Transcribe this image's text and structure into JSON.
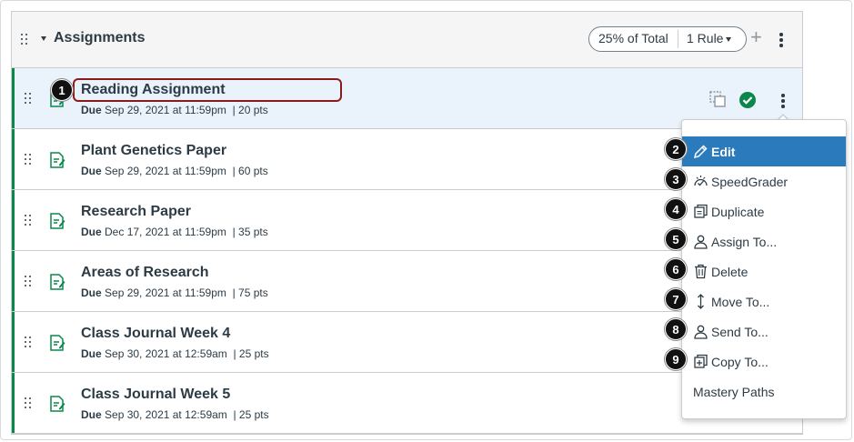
{
  "group": {
    "title": "Assignments",
    "weight_label": "25% of Total",
    "rule_label": "1 Rule"
  },
  "assignments": [
    {
      "title": "Reading Assignment",
      "due_label": "Due",
      "due": "Sep 29, 2021 at 11:59pm",
      "points": "| 20 pts"
    },
    {
      "title": "Plant Genetics Paper",
      "due_label": "Due",
      "due": "Sep 29, 2021 at 11:59pm",
      "points": "| 60 pts"
    },
    {
      "title": "Research Paper",
      "due_label": "Due",
      "due": "Dec 17, 2021 at 11:59pm",
      "points": "| 35 pts"
    },
    {
      "title": "Areas of Research",
      "due_label": "Due",
      "due": "Sep 29, 2021 at 11:59pm",
      "points": "| 75 pts"
    },
    {
      "title": "Class Journal Week 4",
      "due_label": "Due",
      "due": "Sep 30, 2021 at 12:59am",
      "points": "| 25 pts"
    },
    {
      "title": "Class Journal Week 5",
      "due_label": "Due",
      "due": "Sep 30, 2021 at 12:59am",
      "points": "| 25 pts"
    }
  ],
  "menu": {
    "items": [
      {
        "label": "Edit",
        "icon": "pencil-icon"
      },
      {
        "label": "SpeedGrader",
        "icon": "speedgrader-icon"
      },
      {
        "label": "Duplicate",
        "icon": "duplicate-icon"
      },
      {
        "label": "Assign To...",
        "icon": "user-icon"
      },
      {
        "label": "Delete",
        "icon": "trash-icon"
      },
      {
        "label": "Move To...",
        "icon": "move-icon"
      },
      {
        "label": "Send To...",
        "icon": "user-icon"
      },
      {
        "label": "Copy To...",
        "icon": "copy-icon"
      },
      {
        "label": "Mastery Paths",
        "icon": ""
      }
    ]
  },
  "callouts": [
    "1",
    "2",
    "3",
    "4",
    "5",
    "6",
    "7",
    "8",
    "9"
  ],
  "colors": {
    "accent_green": "#0b874b",
    "published_green": "#0b874b",
    "menu_active": "#2b7abc",
    "highlight_border": "#8b1a1a",
    "active_row_bg": "#eaf3fb"
  }
}
